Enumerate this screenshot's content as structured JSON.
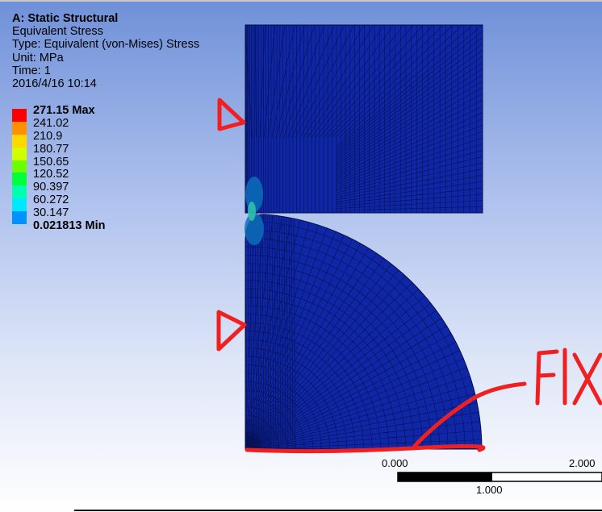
{
  "info": {
    "title": "A: Static Structural",
    "result": "Equivalent Stress",
    "type": "Type: Equivalent (von-Mises) Stress",
    "unit": "Unit: MPa",
    "time": "Time: 1",
    "timestamp": "2016/4/16 10:14"
  },
  "legend": {
    "items": [
      {
        "label": "271.15 Max",
        "color": "#ff0000",
        "bold": true
      },
      {
        "label": "241.02",
        "color": "#ff9000",
        "bold": false
      },
      {
        "label": "210.9",
        "color": "#ffd800",
        "bold": false
      },
      {
        "label": "180.77",
        "color": "#d0ff00",
        "bold": false
      },
      {
        "label": "150.65",
        "color": "#6bff00",
        "bold": false
      },
      {
        "label": "120.52",
        "color": "#00ff3c",
        "bold": false
      },
      {
        "label": "90.397",
        "color": "#00ffae",
        "bold": false
      },
      {
        "label": "60.272",
        "color": "#00e8ff",
        "bold": false
      },
      {
        "label": "30.147",
        "color": "#0092ff",
        "bold": false
      },
      {
        "label": "0.021813 Min",
        "color": "#0000ff",
        "bold": true
      }
    ]
  },
  "scale_bar": {
    "left_label": "0.000",
    "right_label": "2.000",
    "mid_label": "1.000"
  },
  "annotations": {
    "fix_label": "FIX"
  },
  "colors": {
    "mesh_fill": "#0f27a6",
    "mesh_line": "#050d46",
    "annotation": "#f02020"
  }
}
